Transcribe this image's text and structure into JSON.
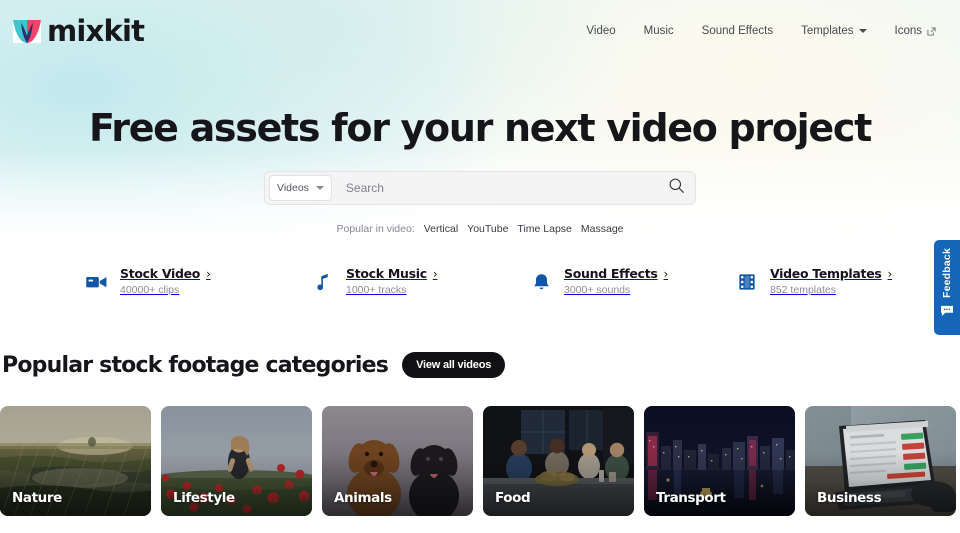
{
  "brand": {
    "name": "mixkit",
    "logo_icon": "mixkit-logo-icon"
  },
  "nav": {
    "items": [
      {
        "label": "Video",
        "icon": null
      },
      {
        "label": "Music",
        "icon": null
      },
      {
        "label": "Sound Effects",
        "icon": null
      },
      {
        "label": "Templates",
        "icon": "chevron-down-icon"
      },
      {
        "label": "Icons",
        "icon": "external-link-icon"
      }
    ]
  },
  "hero": {
    "title": "Free assets for your next video project",
    "search": {
      "filter_value": "Videos",
      "placeholder": "Search",
      "value": "",
      "submit_icon": "search-icon"
    },
    "popular": {
      "label": "Popular in video:",
      "tags": [
        "Vertical",
        "YouTube",
        "Time Lapse",
        "Massage"
      ]
    }
  },
  "quick_links": [
    {
      "title": "Stock Video",
      "sub": "40000+ clips",
      "icon": "video-camera-icon",
      "chevron": "›"
    },
    {
      "title": "Stock Music",
      "sub": "1000+ tracks",
      "icon": "music-note-icon",
      "chevron": "›"
    },
    {
      "title": "Sound Effects",
      "sub": "3000+ sounds",
      "icon": "bell-icon",
      "chevron": "›"
    },
    {
      "title": "Video Templates",
      "sub": "852 templates",
      "icon": "film-strip-icon",
      "chevron": "›"
    }
  ],
  "section": {
    "title": "Popular stock footage categories",
    "button_label": "View all videos"
  },
  "categories": [
    {
      "label": "Nature"
    },
    {
      "label": "Lifestyle"
    },
    {
      "label": "Animals"
    },
    {
      "label": "Food"
    },
    {
      "label": "Transport"
    },
    {
      "label": "Business"
    }
  ],
  "feedback": {
    "label": "Feedback",
    "icon": "speech-bubble-icon"
  },
  "colors": {
    "accent_blue": "#1565b8",
    "logo_teal": "#3ec6d0",
    "logo_pink": "#f0436b",
    "logo_navy": "#2b2b6b",
    "text_dark": "#16161a",
    "text_muted": "#8d8d95"
  }
}
